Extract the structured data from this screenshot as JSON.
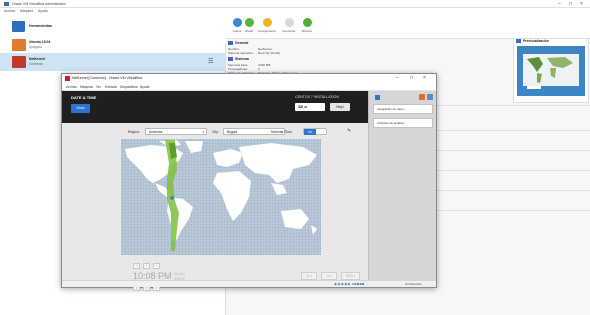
{
  "host": {
    "title": "Oracle VM VirtualBox Administrador",
    "menu": [
      "Archivo",
      "Máquina",
      "Ayuda"
    ],
    "tools_label": "Herramientas",
    "vms": [
      {
        "name": "Ubuntu 18.04",
        "state": "Apagada",
        "color": "#e07a2e"
      },
      {
        "name": "NetKernel",
        "state": "Corriendo",
        "color": "#c0392b"
      }
    ],
    "toolbar": [
      "Nueva",
      "Añadir",
      "Configuración",
      "Descartar",
      "Mostrar"
    ],
    "details": {
      "general_header": "General",
      "general_rows": [
        [
          "Nombre:",
          "NetKernel"
        ],
        [
          "Sistema operativo:",
          "Red Hat (64-bit)"
        ]
      ],
      "system_header": "Sistema",
      "system_rows": [
        [
          "Memoria base:",
          "2048 MB"
        ],
        [
          "Procesadores:",
          "2"
        ],
        [
          "Orden de arranque:",
          "Disquete, Óptico, Disco duro"
        ],
        [
          "Aceleración:",
          "VT-x/AMD-V, Paginación anidada, KVM"
        ]
      ],
      "preview_header": "Previsualización"
    }
  },
  "guest": {
    "title": "NetKernel [Corriendo] - Oracle VM VirtualBox",
    "menu": [
      "Archivo",
      "Máquina",
      "Ver",
      "Entrada",
      "Dispositivos",
      "Ayuda"
    ],
    "installer": {
      "section_title": "DATE & TIME",
      "done_label": "Done",
      "product_title": "CENTOS 7 INSTALLATION",
      "keyboard_value": "us",
      "help_label": "Help!",
      "region_label": "Region:",
      "region_value": "Americas",
      "city_label": "City:",
      "city_value": "Bogota",
      "network_time_label": "Network Time",
      "network_time_state": "ON",
      "clock_value": "10:08 PM",
      "ampm": [
        "24-hour",
        "AM/PM"
      ],
      "date_fields": [
        "11",
        "12",
        "2020"
      ]
    },
    "side_panel": [
      {
        "label": "Integración de ratón..."
      },
      {
        "label": "Inclusión de teclado..."
      }
    ],
    "status_host_key": "Ctrl Derecho"
  },
  "colors": {
    "accent": "#2f74d0",
    "map_land": "#ffffff",
    "map_sea": "#b8c7d6",
    "timezone_highlight": "#7ec03b"
  }
}
